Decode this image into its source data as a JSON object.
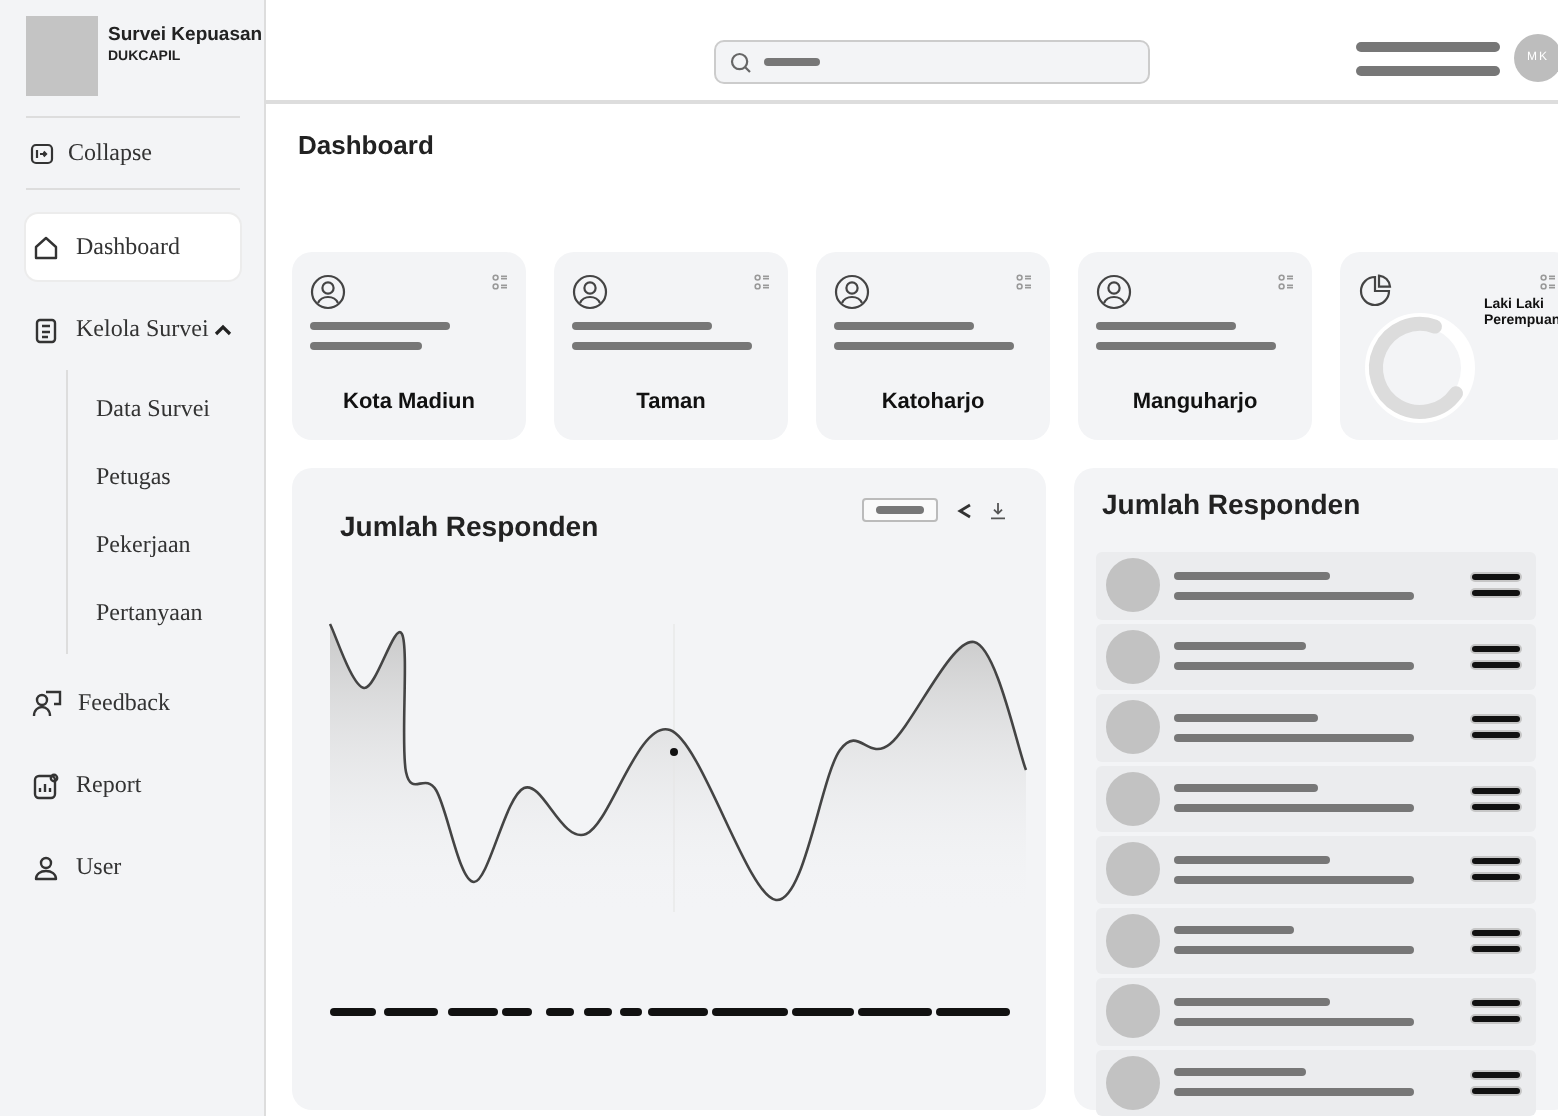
{
  "sidebar": {
    "brand": {
      "title": "Survei Kepuasan",
      "subtitle": "DUKCAPIL"
    },
    "collapse": {
      "label": "Collapse"
    },
    "items": [
      {
        "label": "Dashboard",
        "selected": true
      },
      {
        "label": "Kelola Survei",
        "selected": false,
        "expanded": true,
        "children": [
          {
            "label": "Data Survei",
            "selected": false
          },
          {
            "label": "Petugas",
            "selected": false
          },
          {
            "label": "Pekerjaan",
            "selected": false
          },
          {
            "label": "Pertanyaan",
            "selected": false
          }
        ]
      },
      {
        "label": "Feedback",
        "selected": false
      },
      {
        "label": "Report",
        "selected": false
      },
      {
        "label": "User",
        "selected": false
      }
    ]
  },
  "header": {
    "avatar": {
      "initials": "MK"
    }
  },
  "page_title": "Dashboard",
  "stat_cards": [
    {
      "kind": "region",
      "label": "Kota Madiun"
    },
    {
      "kind": "region",
      "label": "Taman"
    },
    {
      "kind": "region",
      "label": "Katoharjo"
    },
    {
      "kind": "region",
      "label": "Manguharjo"
    },
    {
      "kind": "gender",
      "legend": [
        "Laki Laki",
        "Perempuan"
      ]
    }
  ],
  "chart_card": {
    "title": "Jumlah Responden"
  },
  "list_card": {
    "title": "Jumlah Responden",
    "rows": [
      {
        "kind": "placeholder"
      },
      {
        "kind": "placeholder"
      },
      {
        "kind": "placeholder"
      },
      {
        "kind": "placeholder"
      },
      {
        "kind": "placeholder"
      },
      {
        "kind": "placeholder"
      },
      {
        "kind": "placeholder"
      },
      {
        "kind": "placeholder"
      }
    ]
  }
}
